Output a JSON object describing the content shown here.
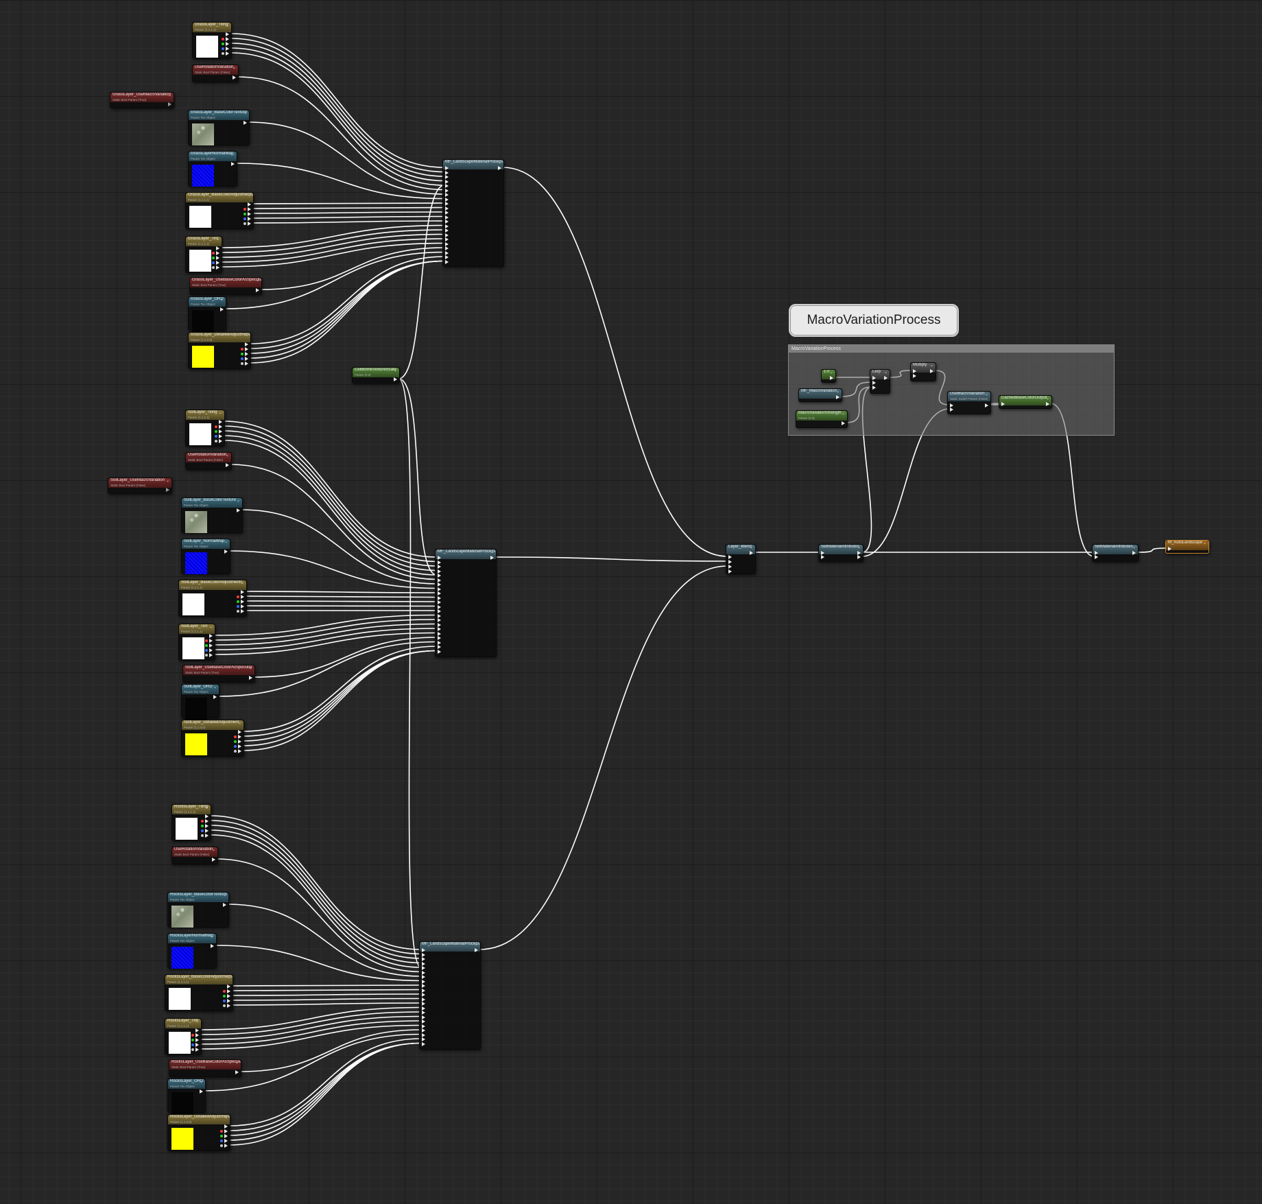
{
  "comment": {
    "title": "MacroVariationProcess",
    "box_label": "MacroVariationProcess"
  },
  "colors": {
    "wire": "#ffffff",
    "scalar_param": "#8a7a3c",
    "texture_param": "#3d6e80",
    "bool_param": "#7a2a2a",
    "constant": "#5a8a3c",
    "function_call": "#4f6f7c",
    "output": "#c6852a"
  },
  "groups": [
    {
      "name": "grass",
      "nodes": {
        "tiling": {
          "title": "GrassLayer_Tiling",
          "sub": "Param (1,1,1,1)"
        },
        "rotation": {
          "title": "UseRotationVariation",
          "sub": "Static Bool Param (False)"
        },
        "macro": {
          "title": "GrassLayer_UseMacroVariation",
          "sub": "Static Bool Param (True)"
        },
        "base_tex": {
          "title": "GrassLayer_BaseColorTexture",
          "sub": "Param Tex Object"
        },
        "normal": {
          "title": "GrassLayerNormalMap",
          "sub": "Param Tex Object"
        },
        "adjust": {
          "title": "GrassLayer_BaseColorAdjustments",
          "sub": "Param (1,1,1,1)"
        },
        "tint": {
          "title": "GrassLayer_Tint",
          "sub": "Param (1,1,1,1)"
        },
        "spec": {
          "title": "GrassLayer_UseBaseColorAsSpecular",
          "sub": "Static Bool Param (True)"
        },
        "orm": {
          "title": "GrassLayer_ORD",
          "sub": "Param Tex Object"
        },
        "detail": {
          "title": "GrassLayer_DetailedAdjustment",
          "sub": "Param (1,1,0,0)"
        }
      },
      "function": "MF_LandscapeMaterialProcess"
    },
    {
      "name": "soil",
      "nodes": {
        "tiling": {
          "title": "SoilLayer_Tiling",
          "sub": "Param (1,1,1,1)"
        },
        "rotation": {
          "title": "UseRotationVariation",
          "sub": "Static Bool Param (False)"
        },
        "macro": {
          "title": "SoilLayer_UseMacroVariation",
          "sub": "Static Bool Param (False)"
        },
        "base_tex": {
          "title": "SoilLayer_BaseColorTexture",
          "sub": "Param Tex Object"
        },
        "normal": {
          "title": "SoilLayer_NormalMap",
          "sub": "Param Tex Object"
        },
        "adjust": {
          "title": "SoilLayer_BaseColorAdjustments",
          "sub": "Param (1,1,1,1)"
        },
        "tint": {
          "title": "SoilLayer_Tint",
          "sub": "Param (1,1,1,1)"
        },
        "spec": {
          "title": "SoilLayer_UseBaseColorAsSpecular",
          "sub": "Static Bool Param (True)"
        },
        "orm": {
          "title": "SoilLayer_ORD",
          "sub": "Param Tex Object"
        },
        "detail": {
          "title": "SoilLayer_DetailedAdjustment",
          "sub": "Param (1,1,0,0)"
        }
      },
      "function": "MF_LandscapeMaterialProcess"
    },
    {
      "name": "rocks",
      "nodes": {
        "tiling": {
          "title": "RocksLayer_Tiling",
          "sub": "Param (1,1,1,1)"
        },
        "rotation": {
          "title": "UseRotationVariation",
          "sub": "Static Bool Param (False)"
        },
        "base_tex": {
          "title": "RocksLayer_BaseColorTexture",
          "sub": "Param Tex Object"
        },
        "normal": {
          "title": "RocksLayerNormalMap",
          "sub": "Param Tex Object"
        },
        "adjust": {
          "title": "RocksLayer_BaseColorAdjustments",
          "sub": "Param (1,1,1,1)"
        },
        "tint": {
          "title": "RocksLayer_Tint",
          "sub": "Param (1,1,1,1)"
        },
        "spec": {
          "title": "RocksLayer_UseBaseColorAsSpecular",
          "sub": "Static Bool Param (True)"
        },
        "orm": {
          "title": "RocksLayer_ORD",
          "sub": "Param Tex Object"
        },
        "detail": {
          "title": "RocksLayer_DetailedAdjustment",
          "sub": "Param (1,1,0,0)"
        }
      },
      "function": "MF_LandscapeMaterialProcess"
    }
  ],
  "shared": {
    "cellbomb": {
      "title": "CellBombTextureScale",
      "sub": "Param (0.5)"
    }
  },
  "blend": {
    "title": "Layer_Blend"
  },
  "set_attr_1": {
    "title": "SetMaterialAttributes"
  },
  "set_attr_2": {
    "title": "SetMaterialAttributes"
  },
  "output": {
    "title": "M_AutoLandscape"
  },
  "macro_nodes": {
    "const": {
      "title": "1.0"
    },
    "mf_macro": {
      "title": "MF_MacroVariation"
    },
    "strength": {
      "title": "MacroVariationStrength",
      "sub": "Param (0.5)"
    },
    "lerp": {
      "title": "Lerp"
    },
    "multiply": {
      "title": "Multiply"
    },
    "use_macro": {
      "title": "UseMacroVariation",
      "sub": "Static Switch Param (False)"
    },
    "cached": {
      "title": "CachedBaseColorOutput"
    }
  }
}
